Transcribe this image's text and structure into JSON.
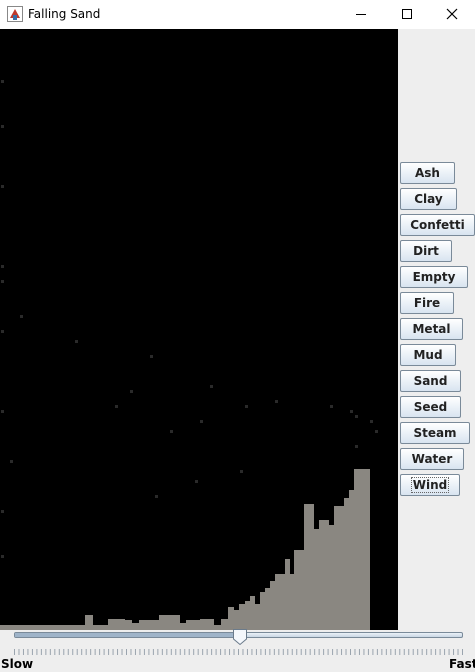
{
  "window": {
    "title": "Falling Sand"
  },
  "elements": [
    {
      "label": "Ash"
    },
    {
      "label": "Clay"
    },
    {
      "label": "Confetti"
    },
    {
      "label": "Dirt"
    },
    {
      "label": "Empty"
    },
    {
      "label": "Fire"
    },
    {
      "label": "Metal"
    },
    {
      "label": "Mud"
    },
    {
      "label": "Sand"
    },
    {
      "label": "Seed"
    },
    {
      "label": "Steam"
    },
    {
      "label": "Water"
    },
    {
      "label": "Wind"
    }
  ],
  "selected_element": "Wind",
  "speed": {
    "min_label": "Slow",
    "max_label": "Fast",
    "value": 0.505
  },
  "colors": {
    "canvas_bg": "#000000",
    "ash": "#8a8781",
    "ash_particle": "#2a2a2a",
    "panel_bg": "#eeeeee"
  },
  "icons": {
    "app": "falling-sand-app-icon",
    "minimize": "minimize-icon",
    "maximize": "maximize-icon",
    "close": "close-icon"
  }
}
